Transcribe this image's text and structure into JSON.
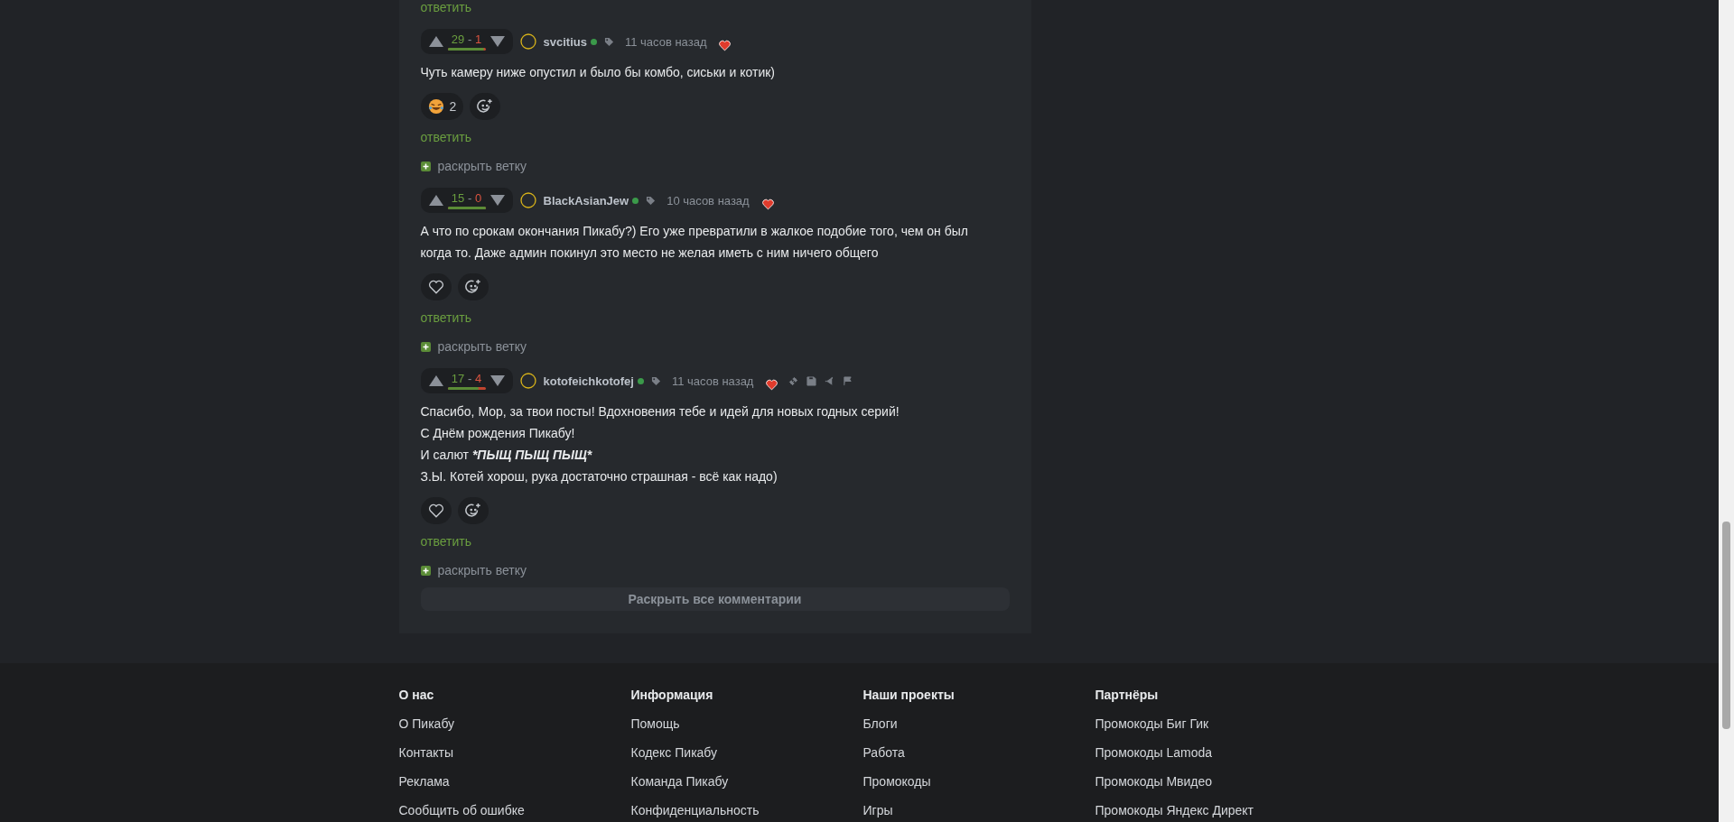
{
  "previous_reply": {
    "label": "ответить"
  },
  "comments": [
    {
      "plus": "29",
      "separator": "-",
      "minus": "1",
      "level": 0.97,
      "username": "svcitius",
      "online": true,
      "time": "11 часов назад",
      "show_actions": false,
      "lines": [
        [
          {
            "text": "Чуть камеру ниже опустил и было бы комбо, сиськи и котик)",
            "emphasis": false
          }
        ]
      ],
      "reactions": [
        {
          "kind": "laugh",
          "count": "2"
        },
        {
          "kind": "add"
        }
      ],
      "reply": "ответить",
      "expand": "раскрыть ветку"
    },
    {
      "plus": "15",
      "separator": "-",
      "minus": "0",
      "level": 1,
      "username": "BlackAsianJew",
      "online": true,
      "time": "10 часов назад",
      "show_actions": false,
      "lines": [
        [
          {
            "text": "А что по срокам окончания Пикабу?) Его уже превратили в жалкое подобие того, чем он был когда то. Даже админ покинул это место не желая иметь с ним ничего общего",
            "emphasis": false
          }
        ]
      ],
      "reactions": [
        {
          "kind": "heart"
        },
        {
          "kind": "add"
        }
      ],
      "reply": "ответить",
      "expand": "раскрыть ветку"
    },
    {
      "plus": "17",
      "separator": "-",
      "minus": "4",
      "level": 0.81,
      "username": "kotofeichkotofej",
      "online": true,
      "time": "11 часов назад",
      "show_actions": true,
      "lines": [
        [
          {
            "text": "Спасибо, Мор, за твои посты! Вдохновения тебе и идей для новых годных серий!",
            "emphasis": false
          }
        ],
        [
          {
            "text": "С Днём рождения Пикабу!",
            "emphasis": false
          }
        ],
        [
          {
            "text": "И салют ",
            "emphasis": false
          },
          {
            "text": "*ПЫЩ ПЫЩ ПЫЩ*",
            "emphasis": true
          }
        ],
        [
          {
            "text": "З.Ы. Котей хорош, рука достаточно страшная - всё как надо)",
            "emphasis": false
          }
        ]
      ],
      "reactions": [
        {
          "kind": "heart"
        },
        {
          "kind": "add"
        }
      ],
      "reply": "ответить",
      "expand": "раскрыть ветку"
    }
  ],
  "expand_all": {
    "label": "Раскрыть все комментарии"
  },
  "footer": {
    "columns": [
      {
        "title": "О нас",
        "links": [
          "О Пикабу",
          "Контакты",
          "Реклама",
          "Сообщить об ошибке"
        ]
      },
      {
        "title": "Информация",
        "links": [
          "Помощь",
          "Кодекс Пикабу",
          "Команда Пикабу",
          "Конфиденциальность"
        ]
      },
      {
        "title": "Наши проекты",
        "links": [
          "Блоги",
          "Работа",
          "Промокоды",
          "Игры"
        ]
      },
      {
        "title": "Партнёры",
        "links": [
          "Промокоды Биг Гик",
          "Промокоды Lamoda",
          "Промокоды Мвидео",
          "Промокоды Яндекс Директ"
        ]
      }
    ]
  }
}
